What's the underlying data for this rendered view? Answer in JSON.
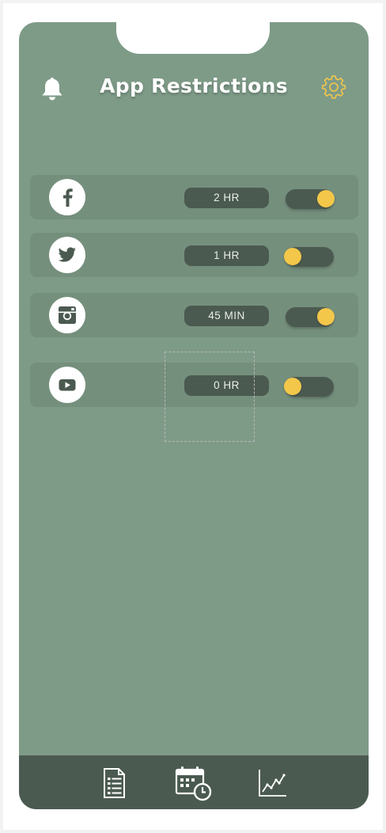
{
  "header": {
    "title": "App Restrictions",
    "bell_icon": "bell-icon",
    "settings_icon": "gear-icon"
  },
  "apps": [
    {
      "name": "Facebook",
      "icon": "facebook-icon",
      "limit": "2 HR",
      "enabled": true
    },
    {
      "name": "Twitter",
      "icon": "twitter-icon",
      "limit": "1 HR",
      "enabled": false
    },
    {
      "name": "Instagram",
      "icon": "instagram-icon",
      "limit": "45 MIN",
      "enabled": true
    },
    {
      "name": "YouTube",
      "icon": "youtube-icon",
      "limit": "0 HR",
      "enabled": false
    }
  ],
  "tabbar": {
    "items": [
      {
        "icon": "checklist-icon"
      },
      {
        "icon": "calendar-clock-icon"
      },
      {
        "icon": "line-chart-icon"
      }
    ]
  },
  "colors": {
    "background": "#7e9b88",
    "row": "#758f7d",
    "dark": "#4b5a50",
    "accent": "#f3c74a",
    "text": "#ffffff"
  }
}
